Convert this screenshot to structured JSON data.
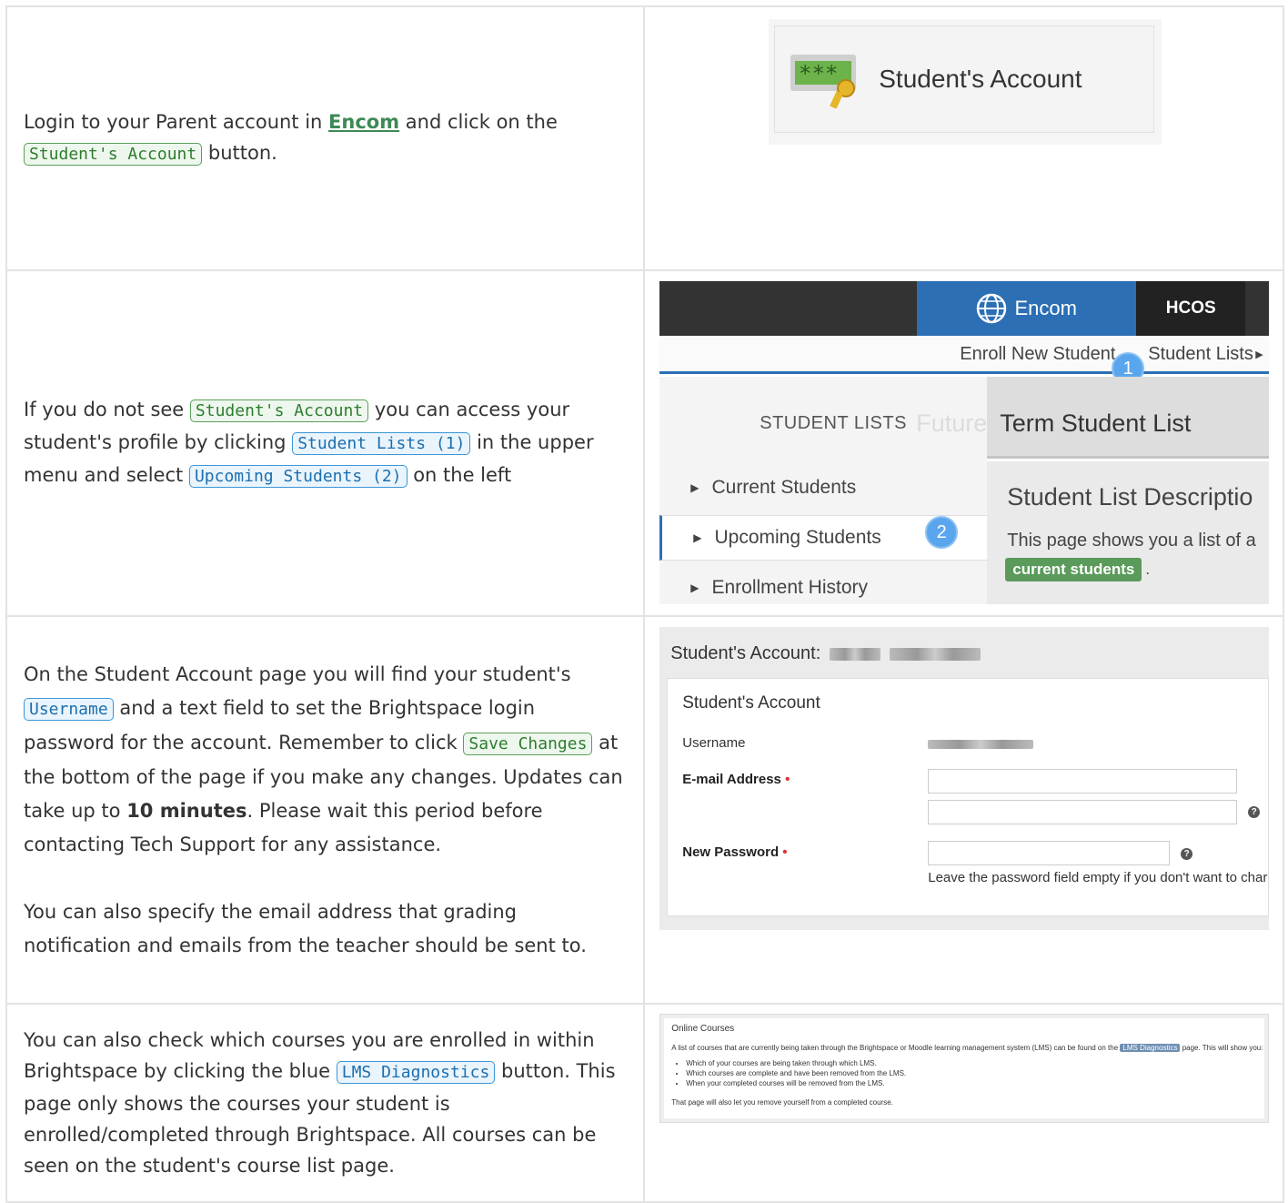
{
  "rows": [
    {
      "text_before": "Login to your Parent account in ",
      "link": "Encom",
      "text_mid": " and click on the ",
      "code": "Student's Account",
      "text_after": " button."
    },
    {
      "text_before": "If you do not see ",
      "code1": "Student's Account",
      "text_mid1": " you can access your student's profile by clicking ",
      "code2": "Student Lists (1)",
      "text_mid2": " in the upper menu and select ",
      "code3": "Upcoming Students (2)",
      "text_after": " on the left"
    },
    {
      "p1_a": "On the Student Account page you will find your student's ",
      "code1": "Username",
      "p1_b": " and a text field to set the Brightspace login password for the account. Remember to click ",
      "code2": "Save Changes",
      "p1_c": " at the bottom of the page if you make any changes. Updates can take up to ",
      "bold": "10 minutes",
      "p1_d": ". Please wait this period before contacting Tech Support for any assistance.",
      "p2": "You can also specify the email address that grading notification and emails from the teacher should be sent to."
    },
    {
      "text_before": "You can also check which courses you are enrolled in within Brightspace by clicking the blue ",
      "code": "LMS Diagnostics",
      "text_after": " button. This page only shows the courses your student is enrolled/completed through Brightspace. All courses can be seen on the student's course list page."
    }
  ],
  "shot1": {
    "button_label": "Student's Account",
    "icon": "key-password-icon",
    "stars": "***"
  },
  "shot2": {
    "brand": "Encom",
    "org": "HCOS",
    "menu_enroll": "Enroll New Student",
    "menu_lists": "Student Lists",
    "badge1": "1",
    "badge2": "2",
    "side_title": "STUDENT LISTS",
    "side_items": [
      "Current Students",
      "Upcoming Students",
      "Enrollment History"
    ],
    "ghost_title": "Future",
    "page_title": "Term Student List",
    "desc_heading": "Student List Descriptio",
    "desc_text": "This page shows you a list of a",
    "tag": "current students",
    "tag_suffix": "."
  },
  "shot3": {
    "header": "Student's Account:",
    "card_title": "Student's Account",
    "username_label": "Username",
    "email_label": "E-mail Address",
    "password_label": "New Password",
    "required_mark": "•",
    "hint": "Leave the password field empty if you don't want to char"
  },
  "shot4": {
    "title": "Online Courses",
    "desc_a": "A list of courses that are currently being taken through the Brightspace or Moodle learning management system (LMS) can be found on the",
    "btn": "LMS Diagnostics",
    "desc_b": "page. This will show you:",
    "bullets": [
      "Which of your courses are being taken through which LMS.",
      "Which courses are complete and have been removed from the LMS.",
      "When your completed courses will be removed from the LMS."
    ],
    "footer": "That page will also let you remove yourself from a completed course."
  }
}
